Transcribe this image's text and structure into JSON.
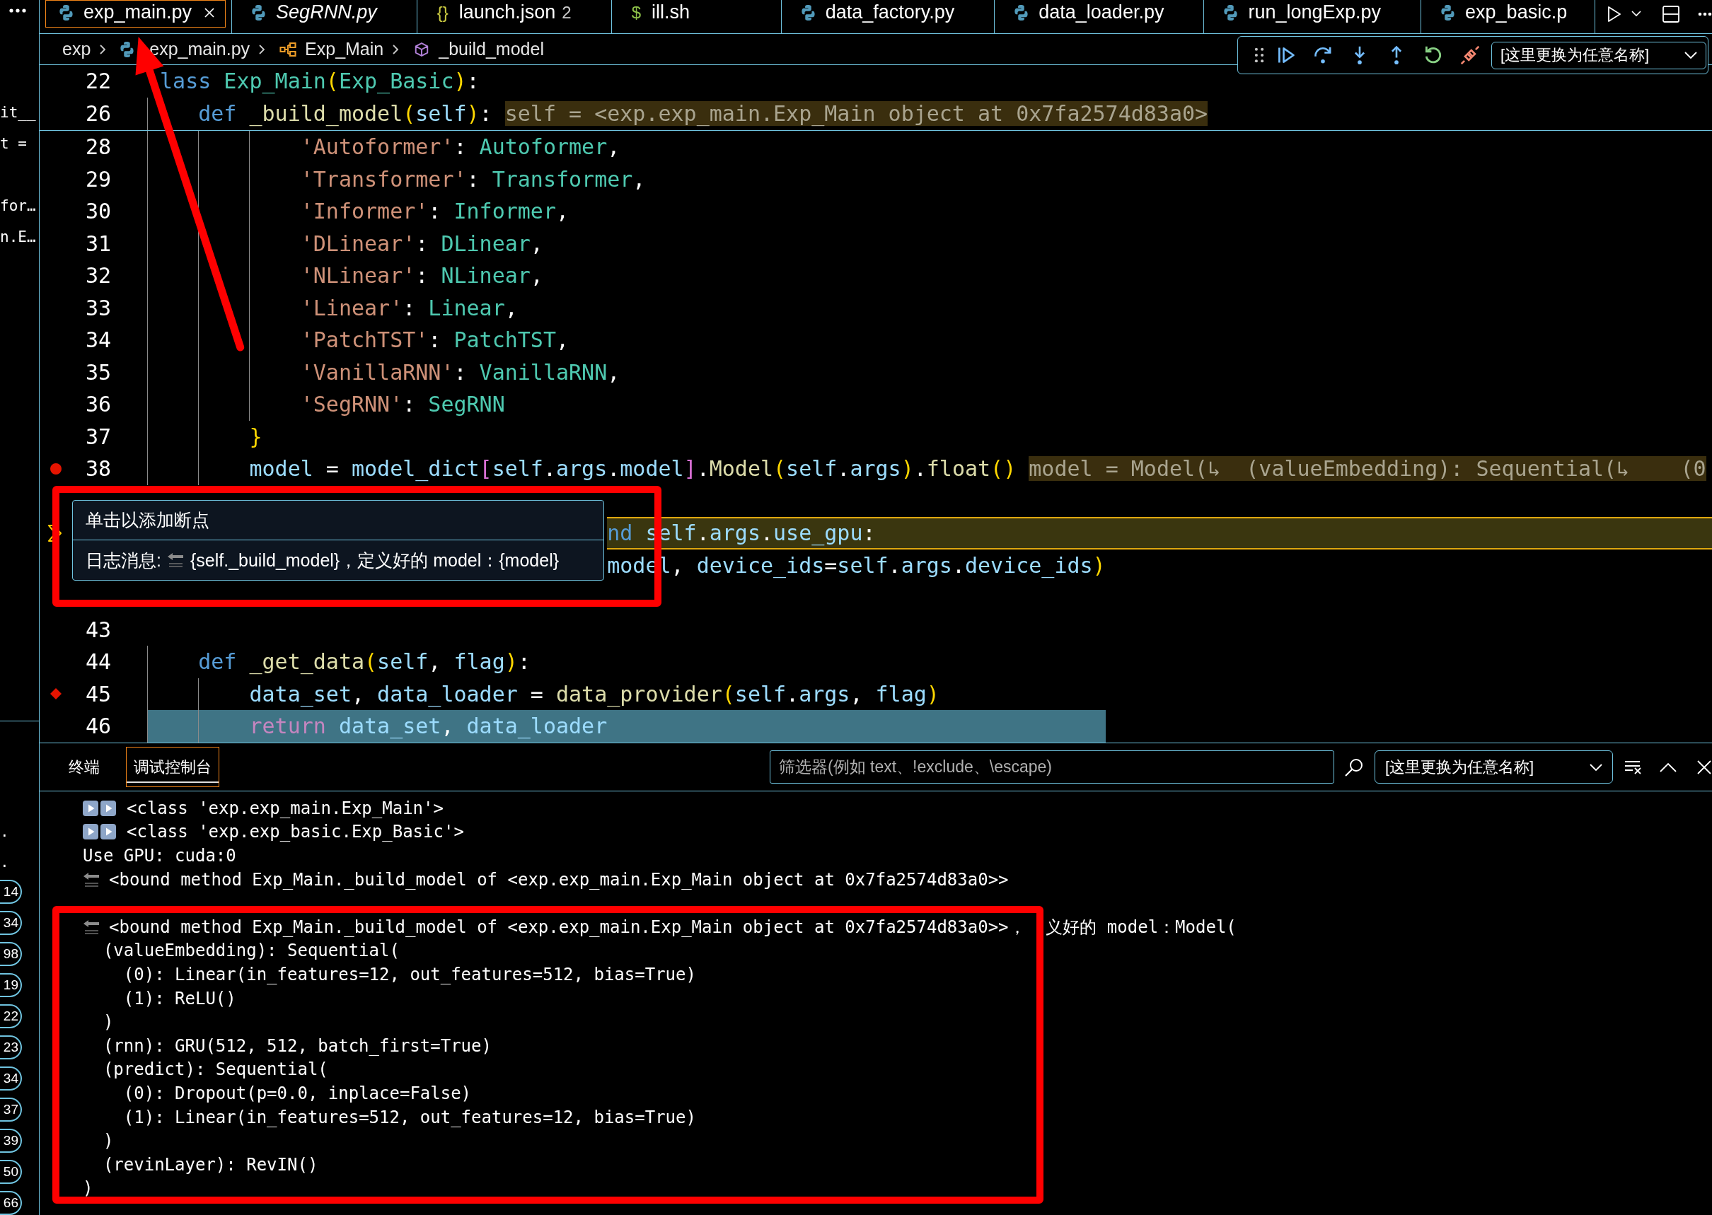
{
  "sidebar": {
    "variables": [
      "it__",
      "t =",
      "for…",
      "n.E…"
    ],
    "fragments": [
      ".",
      "."
    ],
    "badges": [
      "14",
      "34",
      "98",
      "19",
      "22",
      "23",
      "34",
      "37",
      "39",
      "50",
      "66"
    ]
  },
  "tabs": [
    {
      "label": "exp_main.py",
      "kind": "python",
      "selected": true,
      "preview": false
    },
    {
      "label": "SegRNN.py",
      "kind": "python",
      "selected": false,
      "preview": true
    },
    {
      "label": "launch.json",
      "kind": "json",
      "glyph": "{}",
      "problems": "2",
      "selected": false,
      "preview": false
    },
    {
      "label": "ill.sh",
      "kind": "shell",
      "glyph": "$",
      "selected": false,
      "preview": false
    },
    {
      "label": "data_factory.py",
      "kind": "python",
      "selected": false,
      "preview": false
    },
    {
      "label": "data_loader.py",
      "kind": "python",
      "selected": false,
      "preview": false
    },
    {
      "label": "run_longExp.py",
      "kind": "python",
      "selected": false,
      "preview": false
    },
    {
      "label": "exp_basic.p",
      "kind": "python",
      "selected": false,
      "preview": false
    }
  ],
  "breadcrumb": [
    {
      "label": "exp",
      "kind": "folder"
    },
    {
      "label": "exp_main.py",
      "kind": "file"
    },
    {
      "label": "Exp_Main",
      "kind": "class"
    },
    {
      "label": "_build_model",
      "kind": "method"
    }
  ],
  "debug_toolbar": {
    "actions": [
      {
        "kind": "continue"
      },
      {
        "kind": "step_over"
      },
      {
        "kind": "step_into"
      },
      {
        "kind": "step_out"
      },
      {
        "kind": "restart"
      },
      {
        "kind": "disconnect"
      }
    ],
    "session": "[这里更换为任意名称]"
  },
  "editor": {
    "sticky": [
      {
        "number": "22",
        "tokens": [
          {
            "text": " lass",
            "kind": "keyword"
          },
          {
            "text": " Exp_Main",
            "kind": "class"
          },
          {
            "text": "(",
            "kind": "bracket"
          },
          {
            "text": "Exp_Basic",
            "kind": "class"
          },
          {
            "text": ")",
            "kind": "bracket"
          },
          {
            "text": ":",
            "kind": "plain"
          }
        ]
      },
      {
        "number": "26",
        "tokens": [
          {
            "text": "    def",
            "kind": "keyword"
          },
          {
            "text": " _build_model",
            "kind": "function"
          },
          {
            "text": "(",
            "kind": "bracket"
          },
          {
            "text": "self",
            "kind": "variable"
          },
          {
            "text": ")",
            "kind": "bracket"
          },
          {
            "text": ":",
            "kind": "plain"
          },
          {
            "text": "self = <exp.exp_main.Exp_Main object at 0x7fa2574d83a0>",
            "kind": "inline"
          }
        ]
      }
    ],
    "lines": [
      {
        "number": "28",
        "kind": "code",
        "current": false,
        "selected": false,
        "tokens": [
          {
            "text": "            'Autoformer'",
            "kind": "string"
          },
          {
            "text": ": ",
            "kind": "plain"
          },
          {
            "text": "Autoformer",
            "kind": "class"
          },
          {
            "text": ",",
            "kind": "plain"
          }
        ]
      },
      {
        "number": "29",
        "kind": "code",
        "current": false,
        "selected": false,
        "tokens": [
          {
            "text": "            'Transformer'",
            "kind": "string"
          },
          {
            "text": ": ",
            "kind": "plain"
          },
          {
            "text": "Transformer",
            "kind": "class"
          },
          {
            "text": ",",
            "kind": "plain"
          }
        ]
      },
      {
        "number": "30",
        "kind": "code",
        "current": false,
        "selected": false,
        "tokens": [
          {
            "text": "            'Informer'",
            "kind": "string"
          },
          {
            "text": ": ",
            "kind": "plain"
          },
          {
            "text": "Informer",
            "kind": "class"
          },
          {
            "text": ",",
            "kind": "plain"
          }
        ]
      },
      {
        "number": "31",
        "kind": "code",
        "current": false,
        "selected": false,
        "tokens": [
          {
            "text": "            'DLinear'",
            "kind": "string"
          },
          {
            "text": ": ",
            "kind": "plain"
          },
          {
            "text": "DLinear",
            "kind": "class"
          },
          {
            "text": ",",
            "kind": "plain"
          }
        ]
      },
      {
        "number": "32",
        "kind": "code",
        "current": false,
        "selected": false,
        "tokens": [
          {
            "text": "            'NLinear'",
            "kind": "string"
          },
          {
            "text": ": ",
            "kind": "plain"
          },
          {
            "text": "NLinear",
            "kind": "class"
          },
          {
            "text": ",",
            "kind": "plain"
          }
        ]
      },
      {
        "number": "33",
        "kind": "code",
        "current": false,
        "selected": false,
        "tokens": [
          {
            "text": "            'Linear'",
            "kind": "string"
          },
          {
            "text": ": ",
            "kind": "plain"
          },
          {
            "text": "Linear",
            "kind": "class"
          },
          {
            "text": ",",
            "kind": "plain"
          }
        ]
      },
      {
        "number": "34",
        "kind": "code",
        "current": false,
        "selected": false,
        "tokens": [
          {
            "text": "            'PatchTST'",
            "kind": "string"
          },
          {
            "text": ": ",
            "kind": "plain"
          },
          {
            "text": "PatchTST",
            "kind": "class"
          },
          {
            "text": ",",
            "kind": "plain"
          }
        ]
      },
      {
        "number": "35",
        "kind": "code",
        "current": false,
        "selected": false,
        "tokens": [
          {
            "text": "            'VanillaRNN'",
            "kind": "string"
          },
          {
            "text": ": ",
            "kind": "plain"
          },
          {
            "text": "VanillaRNN",
            "kind": "class"
          },
          {
            "text": ",",
            "kind": "plain"
          }
        ]
      },
      {
        "number": "36",
        "kind": "code",
        "current": false,
        "selected": false,
        "tokens": [
          {
            "text": "            'SegRNN'",
            "kind": "string"
          },
          {
            "text": ": ",
            "kind": "plain"
          },
          {
            "text": "SegRNN",
            "kind": "class"
          }
        ]
      },
      {
        "number": "37",
        "kind": "code",
        "current": false,
        "selected": false,
        "tokens": [
          {
            "text": "        }",
            "kind": "bracket"
          }
        ]
      },
      {
        "number": "38",
        "kind": "code",
        "marker": {
          "kind": "breakpoint"
        },
        "current": false,
        "selected": false,
        "tokens": [
          {
            "text": "        model",
            "kind": "variable"
          },
          {
            "text": " = ",
            "kind": "plain"
          },
          {
            "text": "model_dict",
            "kind": "variable"
          },
          {
            "text": "[",
            "kind": "bracket2"
          },
          {
            "text": "self",
            "kind": "variable"
          },
          {
            "text": ".",
            "kind": "plain"
          },
          {
            "text": "args",
            "kind": "variable"
          },
          {
            "text": ".",
            "kind": "plain"
          },
          {
            "text": "model",
            "kind": "variable"
          },
          {
            "text": "]",
            "kind": "bracket2"
          },
          {
            "text": ".",
            "kind": "plain"
          },
          {
            "text": "Model",
            "kind": "function"
          },
          {
            "text": "(",
            "kind": "bracket"
          },
          {
            "text": "self",
            "kind": "variable"
          },
          {
            "text": ".",
            "kind": "plain"
          },
          {
            "text": "args",
            "kind": "variable"
          },
          {
            "text": ")",
            "kind": "bracket"
          },
          {
            "text": ".",
            "kind": "plain"
          },
          {
            "text": "float",
            "kind": "function"
          },
          {
            "text": "()",
            "kind": "bracket"
          },
          {
            "text": "model = Model(↳  (valueEmbedding): Sequential(↳    (0",
            "kind": "inline"
          }
        ]
      },
      {
        "kind": "hidden"
      },
      {
        "kind": "covered",
        "marker": {
          "kind": "pointer"
        },
        "current": true,
        "selected": false,
        "tokens": [
          {
            "text": "nd",
            "kind": "keyword"
          },
          {
            "text": " self",
            "kind": "variable"
          },
          {
            "text": ".",
            "kind": "plain"
          },
          {
            "text": "args",
            "kind": "variable"
          },
          {
            "text": ".",
            "kind": "plain"
          },
          {
            "text": "use_gpu",
            "kind": "variable"
          },
          {
            "text": ":",
            "kind": "plain"
          }
        ]
      },
      {
        "kind": "covered",
        "current": false,
        "selected": false,
        "tokens": [
          {
            "text": "model",
            "kind": "variable"
          },
          {
            "text": ", ",
            "kind": "plain"
          },
          {
            "text": "device_ids",
            "kind": "variable"
          },
          {
            "text": "=",
            "kind": "plain"
          },
          {
            "text": "self",
            "kind": "variable"
          },
          {
            "text": ".",
            "kind": "plain"
          },
          {
            "text": "args",
            "kind": "variable"
          },
          {
            "text": ".",
            "kind": "plain"
          },
          {
            "text": "device_ids",
            "kind": "variable"
          },
          {
            "text": ")",
            "kind": "bracket"
          }
        ]
      },
      {
        "kind": "hidden"
      },
      {
        "number": "43",
        "kind": "code",
        "current": false,
        "selected": false
      },
      {
        "number": "44",
        "kind": "code",
        "current": false,
        "selected": false,
        "tokens": [
          {
            "text": "    def",
            "kind": "keyword"
          },
          {
            "text": " _get_data",
            "kind": "function"
          },
          {
            "text": "(",
            "kind": "bracket"
          },
          {
            "text": "self",
            "kind": "variable"
          },
          {
            "text": ", ",
            "kind": "plain"
          },
          {
            "text": "flag",
            "kind": "variable"
          },
          {
            "text": ")",
            "kind": "bracket"
          },
          {
            "text": ":",
            "kind": "plain"
          }
        ]
      },
      {
        "number": "45",
        "kind": "code",
        "marker": {
          "kind": "logpoint"
        },
        "current": false,
        "selected": false,
        "tokens": [
          {
            "text": "        data_set",
            "kind": "variable"
          },
          {
            "text": ", ",
            "kind": "plain"
          },
          {
            "text": "data_loader",
            "kind": "variable"
          },
          {
            "text": " = ",
            "kind": "plain"
          },
          {
            "text": "data_provider",
            "kind": "function"
          },
          {
            "text": "(",
            "kind": "bracket"
          },
          {
            "text": "self",
            "kind": "variable"
          },
          {
            "text": ".",
            "kind": "plain"
          },
          {
            "text": "args",
            "kind": "variable"
          },
          {
            "text": ", ",
            "kind": "plain"
          },
          {
            "text": "flag",
            "kind": "variable"
          },
          {
            "text": ")",
            "kind": "bracket"
          }
        ]
      },
      {
        "number": "46",
        "kind": "code",
        "current": false,
        "selected": true,
        "tokens": [
          {
            "text": "        return",
            "kind": "control"
          },
          {
            "text": " data_set",
            "kind": "variable"
          },
          {
            "text": ", ",
            "kind": "plain"
          },
          {
            "text": "data_loader",
            "kind": "variable"
          }
        ]
      }
    ]
  },
  "hover": {
    "title": "单击以添加断点",
    "label": "日志消息:",
    "message": "{self._build_model}，定义好的 model：{model}"
  },
  "panel": {
    "tabs": [
      {
        "label": "终端",
        "selected": false
      },
      {
        "label": "调试控制台",
        "selected": true
      }
    ],
    "filter": {
      "placeholder": "筛选器(例如 text、!exclude、\\escape)"
    },
    "session": "[这里更换为任意名称]",
    "console": [
      {
        "kind": "arrows",
        "text": "<class 'exp.exp_main.Exp_Main'>"
      },
      {
        "kind": "arrows",
        "text": "<class 'exp.exp_basic.Exp_Basic'>"
      },
      {
        "kind": "plain",
        "text": "Use GPU: cuda:0"
      },
      {
        "kind": "logpoint",
        "text": "<bound method Exp_Main._build_model of <exp.exp_main.Exp_Main object at 0x7fa2574d83a0>>"
      },
      {
        "kind": "hidden"
      },
      {
        "kind": "logpoint",
        "text": "<bound method Exp_Main._build_model of <exp.exp_main.Exp_Main object at 0x7fa2574d83a0>>，",
        "tail": "义好的 model：Model("
      },
      {
        "kind": "plain",
        "text": "  (valueEmbedding): Sequential("
      },
      {
        "kind": "plain",
        "text": "    (0): Linear(in_features=12, out_features=512, bias=True)"
      },
      {
        "kind": "plain",
        "text": "    (1): ReLU()"
      },
      {
        "kind": "plain",
        "text": "  )"
      },
      {
        "kind": "plain",
        "text": "  (rnn): GRU(512, 512, batch_first=True)"
      },
      {
        "kind": "plain",
        "text": "  (predict): Sequential("
      },
      {
        "kind": "plain",
        "text": "    (0): Dropout(p=0.0, inplace=False)"
      },
      {
        "kind": "plain",
        "text": "    (1): Linear(in_features=512, out_features=12, bias=True)"
      },
      {
        "kind": "plain",
        "text": "  )"
      },
      {
        "kind": "plain",
        "text": "  (revinLayer): RevIN()"
      },
      {
        "kind": "plain",
        "text": ")"
      }
    ]
  },
  "annotations": [
    {
      "kind": "arrow"
    },
    {
      "kind": "frame"
    },
    {
      "kind": "frame"
    }
  ]
}
